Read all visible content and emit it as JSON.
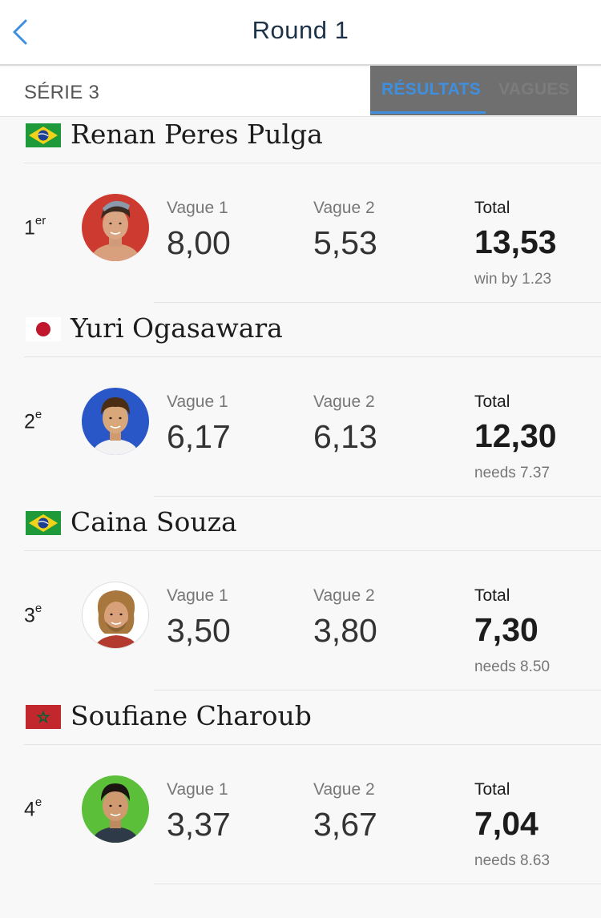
{
  "header": {
    "title": "Round 1"
  },
  "tabs": {
    "series_label": "SÉRIE 3",
    "results_label": "RÉSULTATS",
    "waves_label": "VAGUES"
  },
  "colors": {
    "accent": "#3f8fe0",
    "title": "#1d3148"
  },
  "heats": [
    {
      "name": "Renan Peres Pulga",
      "flag": "brazil-flag-icon",
      "rank_num": "1",
      "rank_suffix": "er",
      "wave1_label": "Vague 1",
      "wave1": "8,00",
      "wave2_label": "Vague 2",
      "wave2": "5,53",
      "total_label": "Total",
      "total": "13,53",
      "status": "win by 1.23",
      "avatar_bg": "#cc3a30"
    },
    {
      "name": "Yuri Ogasawara",
      "flag": "japan-flag-icon",
      "rank_num": "2",
      "rank_suffix": "e",
      "wave1_label": "Vague 1",
      "wave1": "6,17",
      "wave2_label": "Vague 2",
      "wave2": "6,13",
      "total_label": "Total",
      "total": "12,30",
      "status": "needs 7.37",
      "avatar_bg": "#2a57c8"
    },
    {
      "name": "Caina Souza",
      "flag": "brazil-flag-icon",
      "rank_num": "3",
      "rank_suffix": "e",
      "wave1_label": "Vague 1",
      "wave1": "3,50",
      "wave2_label": "Vague 2",
      "wave2": "3,80",
      "total_label": "Total",
      "total": "7,30",
      "status": "needs 8.50",
      "avatar_bg": "#ffffff"
    },
    {
      "name": "Soufiane Charoub",
      "flag": "morocco-flag-icon",
      "rank_num": "4",
      "rank_suffix": "e",
      "wave1_label": "Vague 1",
      "wave1": "3,37",
      "wave2_label": "Vague 2",
      "wave2": "3,67",
      "total_label": "Total",
      "total": "7,04",
      "status": "needs 8.63",
      "avatar_bg": "#5cbf3a"
    }
  ]
}
